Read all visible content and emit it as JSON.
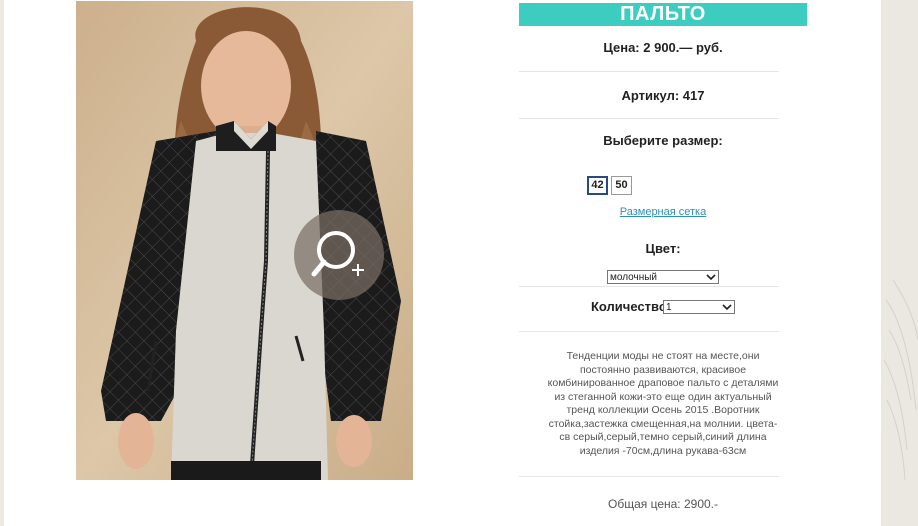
{
  "product": {
    "title": "ПАЛЬТО",
    "price": "Цена: 2 900.— руб.",
    "article": "Артикул: 417",
    "choose_size": "Выберите размер:",
    "sizes": [
      "42",
      "50"
    ],
    "selected_size": "42",
    "size_grid_link": "Размерная сетка",
    "color_label": "Цвет:",
    "color_value": "молочный",
    "quantity_label": "Количество:",
    "quantity_value": "1",
    "description": "Тенденции моды не стоят на месте,они постоянно развиваются, красивое комбинированное драповое пальто с деталями из стеганной кожи-это еще один актуальный тренд коллекции Осень 2015 .Воротник стойка,застежка смещенная,на молнии. цвета-св серый,серый,темно серый,синий длина изделия -70см,длина рукава-63см",
    "total": "Общая цена: 2900.-"
  },
  "icons": {
    "zoom": "zoom-in-icon",
    "dropdown": "chevron-down-icon"
  },
  "colors": {
    "accent": "#3cccc0",
    "link": "#2f8fb0"
  }
}
